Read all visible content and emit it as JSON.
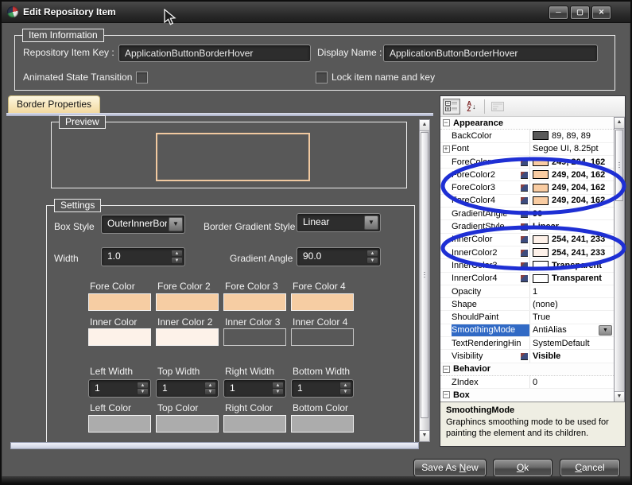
{
  "window": {
    "title": "Edit Repository Item"
  },
  "icons": {
    "minimize": "─",
    "maximize": "▢",
    "close": "✕",
    "dropdown": "▼",
    "spin_up": "▲",
    "spin_down": "▼",
    "scroll_up": "▲",
    "scroll_down": "▼",
    "sort_a": "A",
    "sort_z": "Z",
    "sort_arrow": "↓",
    "expand": "+",
    "collapse": "−"
  },
  "item_information": {
    "legend": "Item Information",
    "key_label": "Repository Item Key :",
    "key_value": "ApplicationButtonBorderHover",
    "display_label": "Display Name :",
    "display_value": "ApplicationButtonBorderHover",
    "animated_label": "Animated State Transition",
    "lock_label": "Lock item name and key"
  },
  "tab": {
    "label": "Border Properties"
  },
  "preview": {
    "legend": "Preview",
    "border_color": "#F1C9A0"
  },
  "settings": {
    "legend": "Settings",
    "box_style_label": "Box Style",
    "box_style_value": "OuterInnerBord",
    "border_gradient_style_label": "Border Gradient Style",
    "border_gradient_style_value": "Linear",
    "width_label": "Width",
    "width_value": "1.0",
    "gradient_angle_label": "Gradient Angle",
    "gradient_angle_value": "90.0",
    "fore_colors": {
      "labels": [
        "Fore Color",
        "Fore Color 2",
        "Fore Color 3",
        "Fore Color 4"
      ],
      "colors": [
        "#F6CDA3",
        "#F6CDA3",
        "#F6CDA3",
        "#F6CDA3"
      ]
    },
    "inner_colors": {
      "labels": [
        "Inner Color",
        "Inner Color 2",
        "Inner Color 3",
        "Inner Color 4"
      ],
      "colors": [
        "#FDF2E9",
        "#FDF2E9",
        "transparent",
        "transparent"
      ]
    },
    "side_widths": {
      "labels": [
        "Left Width",
        "Top Width",
        "Right Width",
        "Bottom Width"
      ],
      "values": [
        "1",
        "1",
        "1",
        "1"
      ]
    },
    "side_colors": {
      "labels": [
        "Left Color",
        "Top Color",
        "Right Color",
        "Bottom Color"
      ],
      "colors": [
        "#ACACAC",
        "#ACACAC",
        "#ACACAC",
        "#ACACAC"
      ]
    }
  },
  "property_grid": {
    "rows": [
      {
        "t": "cat",
        "label": "Appearance"
      },
      {
        "label": "BackColor",
        "value": "89, 89, 89",
        "swatch": "#595959"
      },
      {
        "label": "Font",
        "value": "Segoe UI, 8.25pt",
        "expander": "+"
      },
      {
        "label": "ForeColor",
        "value": "249, 204, 162",
        "swatch": "#F9CCA2",
        "bold": true,
        "icon": true
      },
      {
        "label": "ForeColor2",
        "value": "249, 204, 162",
        "swatch": "#F9CCA2",
        "bold": true,
        "icon": true
      },
      {
        "label": "ForeColor3",
        "value": "249, 204, 162",
        "swatch": "#F9CCA2",
        "bold": true,
        "icon": true
      },
      {
        "label": "ForeColor4",
        "value": "249, 204, 162",
        "swatch": "#F9CCA2",
        "bold": true,
        "icon": true
      },
      {
        "label": "GradientAngle",
        "value": "90",
        "bold": true,
        "icon": true
      },
      {
        "label": "GradientStyle",
        "value": "Linear",
        "bold": true,
        "icon": true
      },
      {
        "label": "InnerColor",
        "value": "254, 241, 233",
        "swatch": "#FEF1E9",
        "bold": true,
        "icon": true
      },
      {
        "label": "InnerColor2",
        "value": "254, 241, 233",
        "swatch": "#FEF1E9",
        "bold": true,
        "icon": true
      },
      {
        "label": "InnerColor3",
        "value": "Transparent",
        "swatch": "#FFFFFF",
        "bold": true,
        "icon": true
      },
      {
        "label": "InnerColor4",
        "value": "Transparent",
        "swatch": "#FFFFFF",
        "bold": true,
        "icon": true
      },
      {
        "label": "Opacity",
        "value": "1"
      },
      {
        "label": "Shape",
        "value": "(none)"
      },
      {
        "label": "ShouldPaint",
        "value": "True"
      },
      {
        "label": "SmoothingMode",
        "value": "AntiAlias",
        "selected": true,
        "dropdown": true
      },
      {
        "label": "TextRenderingHin",
        "value": "SystemDefault"
      },
      {
        "label": "Visibility",
        "value": "Visible",
        "bold": true,
        "icon": true
      },
      {
        "t": "cat",
        "label": "Behavior"
      },
      {
        "label": "ZIndex",
        "value": "0"
      },
      {
        "t": "cat",
        "label": "Box"
      }
    ],
    "selected_highlight": "#316AC5",
    "description_title": "SmoothingMode",
    "description_text": "Graphincs smoothing mode to be used for painting the element and its children."
  },
  "footer": {
    "save": {
      "pre": "Save As ",
      "accel": "N",
      "post": "ew"
    },
    "ok": {
      "pre": "",
      "accel": "O",
      "post": "k"
    },
    "cancel": {
      "pre": "",
      "accel": "C",
      "post": "ancel"
    }
  },
  "annotation": {
    "color": "#1E2FD4"
  }
}
